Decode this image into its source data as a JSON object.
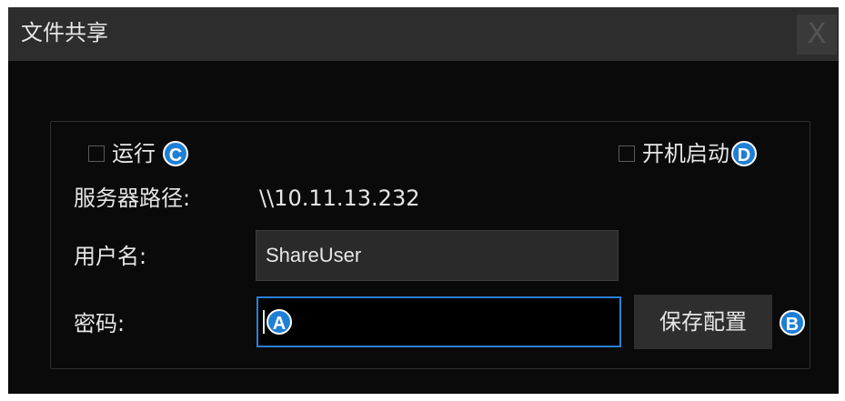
{
  "dialog": {
    "title": "文件共享",
    "close_label": "X"
  },
  "options": {
    "run_label": "运行",
    "run_checked": false,
    "run_badge": "C",
    "autostart_label": "开机启动",
    "autostart_checked": false,
    "autostart_badge": "D"
  },
  "server": {
    "path_label": "服务器路径:",
    "path_value": "\\\\10.11.13.232"
  },
  "username": {
    "label": "用户名:",
    "value": "ShareUser"
  },
  "password": {
    "label": "密码:",
    "value": "",
    "badge": "A"
  },
  "save": {
    "label": "保存配置",
    "badge": "B"
  },
  "colors": {
    "badge": "#1e7fd6",
    "focus_border": "#2a80d8",
    "background": "#0a0a0a",
    "titlebar": "#2d2d2d"
  }
}
